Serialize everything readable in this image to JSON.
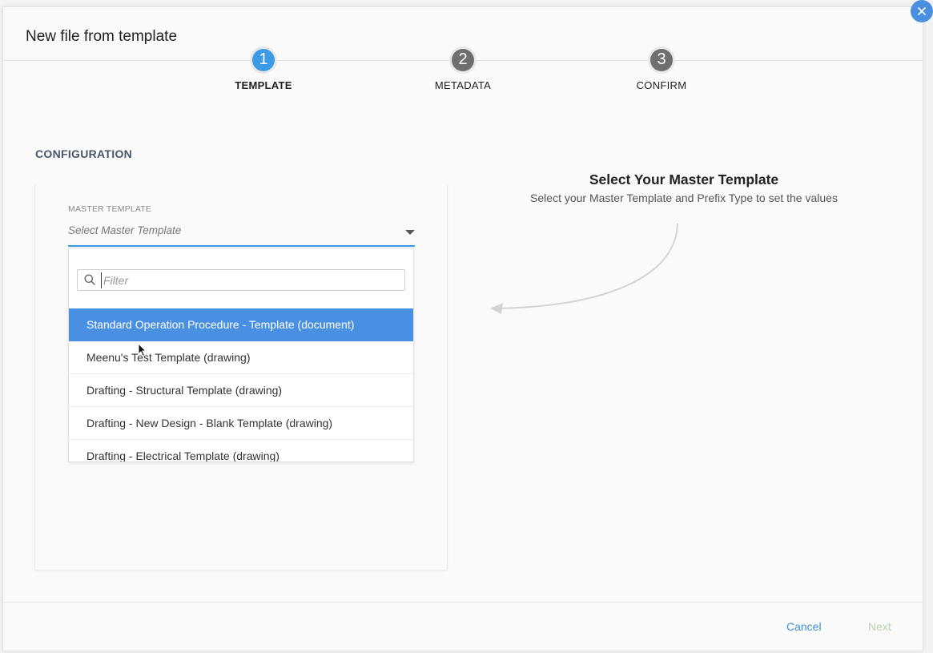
{
  "modal": {
    "title": "New file from template"
  },
  "steps": [
    {
      "number": "1",
      "label": "TEMPLATE",
      "state": "active"
    },
    {
      "number": "2",
      "label": "METADATA",
      "state": "inactive"
    },
    {
      "number": "3",
      "label": "CONFIRM",
      "state": "inactive"
    }
  ],
  "configuration": {
    "section_label": "CONFIGURATION",
    "field_label": "MASTER TEMPLATE",
    "select_placeholder": "Select Master Template",
    "filter_placeholder": "Filter",
    "options": [
      "Standard Operation Procedure - Template (document)",
      "Meenu's Test Template (drawing)",
      "Drafting - Structural Template (drawing)",
      "Drafting - New Design - Blank Template (drawing)",
      "Drafting - Electrical Template (drawing)"
    ],
    "highlighted_option": "Standard Operation Procedure - Template (document)"
  },
  "hint": {
    "title": "Select Your Master Template",
    "subtitle": "Select your Master Template and Prefix Type to set the values"
  },
  "footer": {
    "cancel_label": "Cancel",
    "next_label": "Next"
  },
  "colors": {
    "accent": "#3d9be6",
    "selected_option": "#4a90e2",
    "next_disabled": "#b9d2b0"
  },
  "icons": {
    "close": "close-icon",
    "search": "search-icon",
    "caret": "chevron-down-icon"
  }
}
